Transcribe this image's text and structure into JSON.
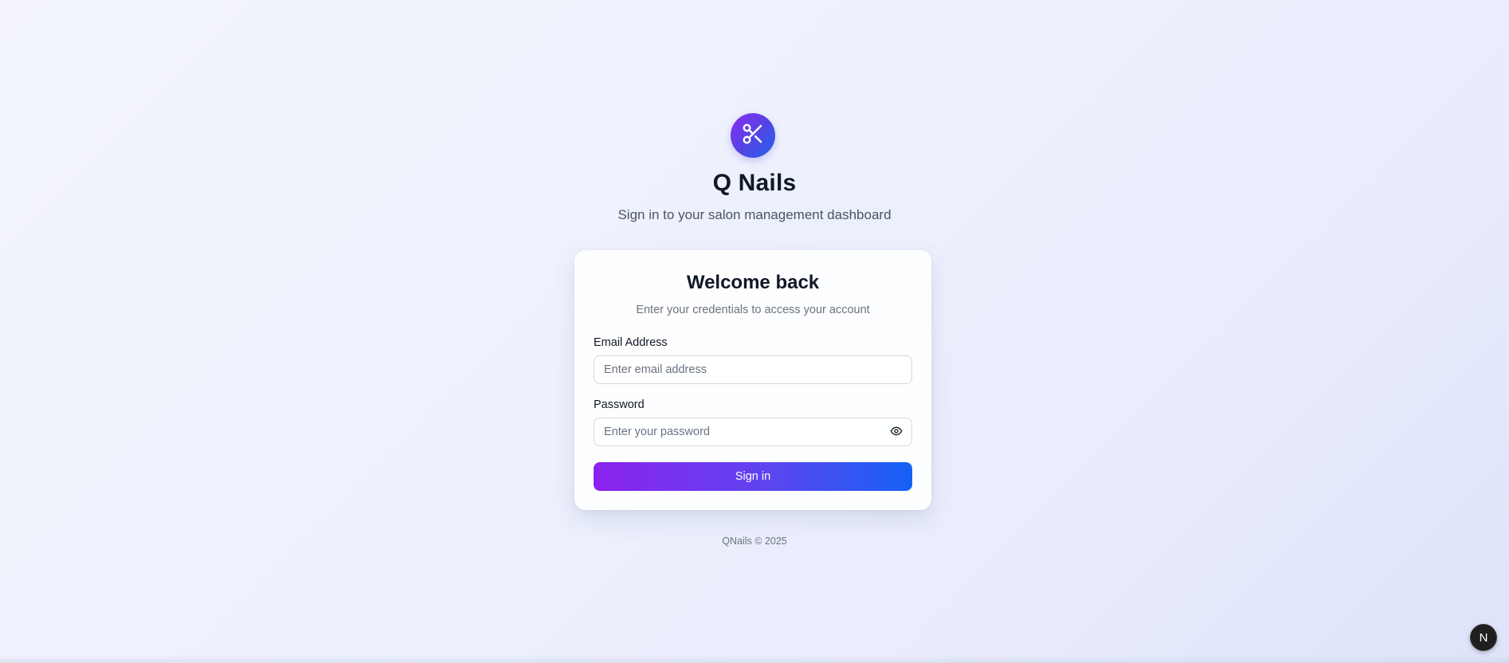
{
  "brand": {
    "icon": "scissors-icon",
    "title": "Q Nails",
    "subtitle": "Sign in to your salon management dashboard",
    "colors": {
      "gradient_start": "#8b22ef",
      "gradient_end": "#1561f5"
    }
  },
  "login_card": {
    "title": "Welcome back",
    "subtitle": "Enter your credentials to access your account",
    "email": {
      "label": "Email Address",
      "placeholder": "Enter email address",
      "value": ""
    },
    "password": {
      "label": "Password",
      "placeholder": "Enter your password",
      "value": "",
      "toggle_icon": "eye-icon"
    },
    "submit_label": "Sign in"
  },
  "footer": {
    "text": "QNails © 2025"
  },
  "dev_badge": {
    "label": "N"
  }
}
